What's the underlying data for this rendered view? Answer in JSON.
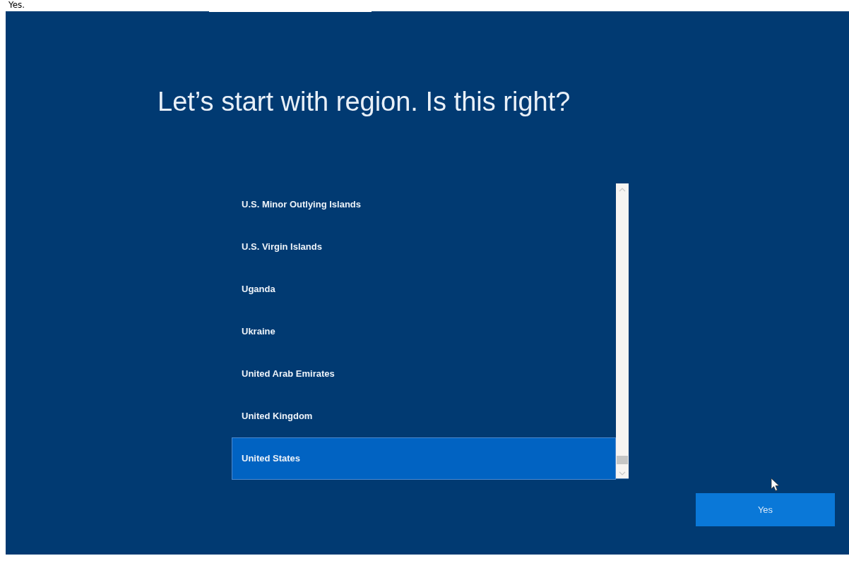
{
  "caption": "Yes.",
  "title": "Let’s start with region. Is this right?",
  "regions": [
    {
      "label": "U.S. Minor Outlying Islands",
      "selected": false
    },
    {
      "label": "U.S. Virgin Islands",
      "selected": false
    },
    {
      "label": "Uganda",
      "selected": false
    },
    {
      "label": "Ukraine",
      "selected": false
    },
    {
      "label": "United Arab Emirates",
      "selected": false
    },
    {
      "label": "United Kingdom",
      "selected": false
    },
    {
      "label": "United States",
      "selected": true
    }
  ],
  "button": "Yes"
}
